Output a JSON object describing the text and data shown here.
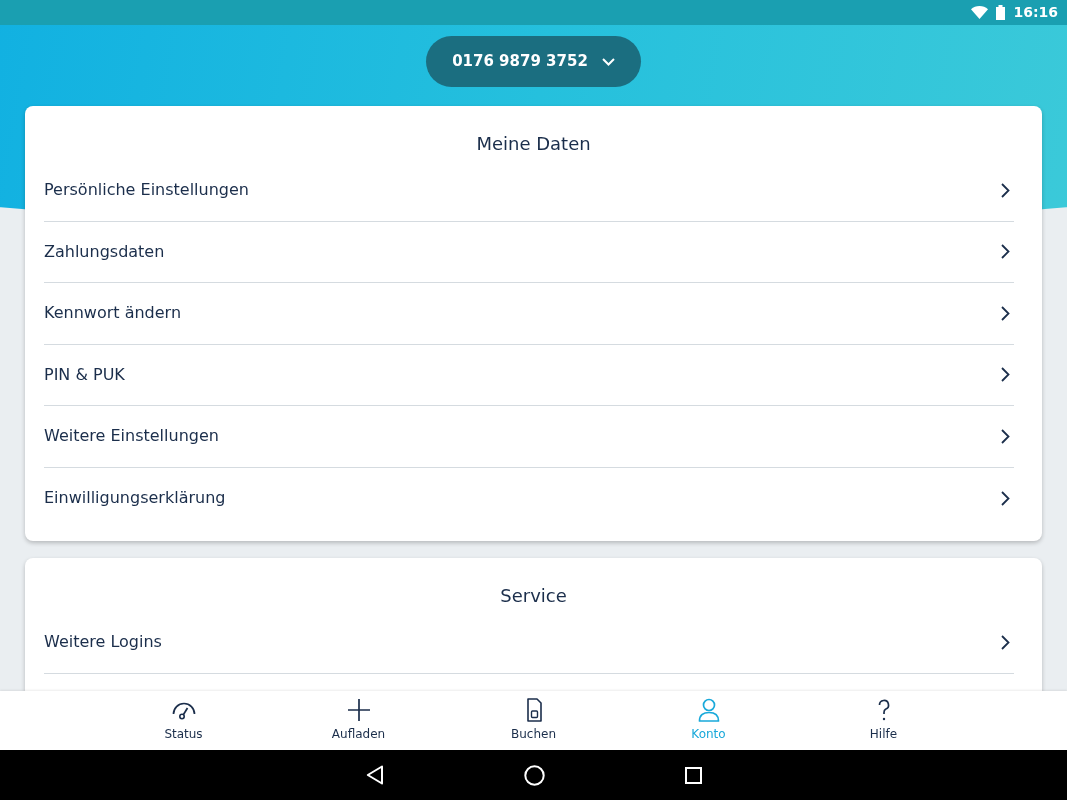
{
  "status_bar": {
    "time": "16:16"
  },
  "number_selector": {
    "number": "0176 9879 3752"
  },
  "sections": [
    {
      "title": "Meine Daten",
      "items": [
        "Persönliche Einstellungen",
        "Zahlungsdaten",
        "Kennwort ändern",
        "PIN & PUK",
        "Weitere Einstellungen",
        "Einwilligungserklärung"
      ]
    },
    {
      "title": "Service",
      "items": [
        "Weitere Logins"
      ]
    }
  ],
  "bottom_nav": [
    {
      "label": "Status",
      "selected": false
    },
    {
      "label": "Aufladen",
      "selected": false
    },
    {
      "label": "Buchen",
      "selected": false
    },
    {
      "label": "Konto",
      "selected": true
    },
    {
      "label": "Hilfe",
      "selected": false
    }
  ]
}
